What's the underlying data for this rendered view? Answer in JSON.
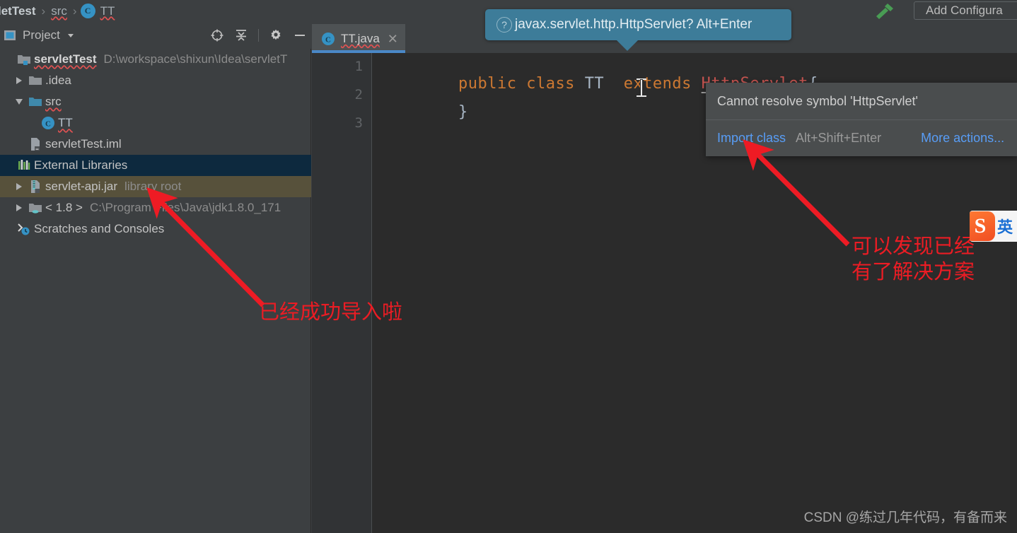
{
  "window": {
    "theme_bg": "#3c3f41",
    "editor_bg": "#2b2b2b",
    "accent": "#4a88c7"
  },
  "breadcrumb": {
    "items": [
      {
        "label": "letTest",
        "style": "bold"
      },
      {
        "label": "src",
        "style": "squiggle"
      },
      {
        "label": "TT",
        "style": "squiggle",
        "icon": "class-icon"
      }
    ],
    "separator": "›"
  },
  "toolbar": {
    "build_icon": "hammer-icon",
    "add_configuration_label": "Add Configura"
  },
  "sidebar": {
    "title": "Project",
    "dropdown_icon": "chevron-down-icon",
    "tools": [
      {
        "name": "locate-icon",
        "glyph": "⊕"
      },
      {
        "name": "collapse-all-icon",
        "glyph": "≡"
      },
      {
        "name": "settings-gear-icon",
        "glyph": "⚙"
      },
      {
        "name": "hide-panel-icon",
        "glyph": "−"
      }
    ],
    "tree": [
      {
        "label": "servletTest",
        "sublabel": "D:\\workspace\\shixun\\Idea\\servletT",
        "icon": "project-folder-icon",
        "twist": "none",
        "indent": 0,
        "bold": true,
        "wavy": true,
        "highlight": "none"
      },
      {
        "label": ".idea",
        "sublabel": "",
        "icon": "folder-icon",
        "twist": "right",
        "indent": 1,
        "bold": false,
        "wavy": false,
        "highlight": "none"
      },
      {
        "label": "src",
        "sublabel": "",
        "icon": "source-folder-icon",
        "twist": "down",
        "indent": 1,
        "bold": false,
        "wavy": true,
        "highlight": "none"
      },
      {
        "label": "TT",
        "sublabel": "",
        "icon": "class-icon",
        "twist": "none",
        "indent": 2,
        "bold": false,
        "wavy": true,
        "highlight": "none"
      },
      {
        "label": "servletTest.iml",
        "sublabel": "",
        "icon": "iml-file-icon",
        "twist": "none",
        "indent": 1,
        "bold": false,
        "wavy": false,
        "highlight": "none"
      },
      {
        "label": "External Libraries",
        "sublabel": "",
        "icon": "external-libraries-icon",
        "twist": "none",
        "indent": 0,
        "bold": false,
        "wavy": false,
        "highlight": "blue"
      },
      {
        "label": "servlet-api.jar",
        "sublabel": "library root",
        "icon": "jar-icon",
        "twist": "right",
        "indent": 1,
        "bold": false,
        "wavy": false,
        "highlight": "olive"
      },
      {
        "label": "< 1.8 >",
        "sublabel": "C:\\Program Files\\Java\\jdk1.8.0_171",
        "icon": "jdk-folder-icon",
        "twist": "right",
        "indent": 1,
        "bold": false,
        "wavy": false,
        "highlight": "none"
      },
      {
        "label": "Scratches and Consoles",
        "sublabel": "",
        "icon": "scratches-icon",
        "twist": "none",
        "indent": 0,
        "bold": false,
        "wavy": false,
        "highlight": "none"
      }
    ]
  },
  "editor": {
    "tab": {
      "label": "TT.java",
      "icon": "java-class-icon",
      "close_glyph": "✕",
      "wavy": true
    },
    "line_numbers": [
      "1",
      "2",
      "3"
    ],
    "lines": [
      {
        "tokens": [
          {
            "text": "public",
            "kind": "keyword"
          },
          {
            "text": " ",
            "kind": "plain"
          },
          {
            "text": "class",
            "kind": "keyword"
          },
          {
            "text": " ",
            "kind": "plain"
          },
          {
            "text": "TT",
            "kind": "identifier"
          },
          {
            "text": "  ",
            "kind": "plain"
          },
          {
            "text": "extends",
            "kind": "keyword"
          },
          {
            "text": " ",
            "kind": "plain"
          },
          {
            "text": "HttpServlet",
            "kind": "error"
          },
          {
            "text": "{",
            "kind": "brace"
          }
        ]
      },
      {
        "tokens": [
          {
            "text": "}",
            "kind": "brace"
          }
        ]
      },
      {
        "tokens": []
      }
    ]
  },
  "hint_bubble": {
    "icon": "question-mark-icon",
    "text": "javax.servlet.http.HttpServlet? Alt+Enter"
  },
  "quickfix_popup": {
    "message": "Cannot resolve symbol 'HttpServlet'",
    "primary_action": "Import class",
    "primary_shortcut": "Alt+Shift+Enter",
    "more_action": "More actions..."
  },
  "annotations": [
    {
      "name": "import-success-note",
      "text": "已经成功导入啦",
      "color": "#ec1c24"
    },
    {
      "name": "solution-found-note",
      "text": "可以发现已经\n有了解决方案",
      "color": "#ec1c24"
    }
  ],
  "ime_badge": {
    "logo_letter": "S",
    "text": "英"
  },
  "watermark": "CSDN @练过几年代码，有备而来"
}
